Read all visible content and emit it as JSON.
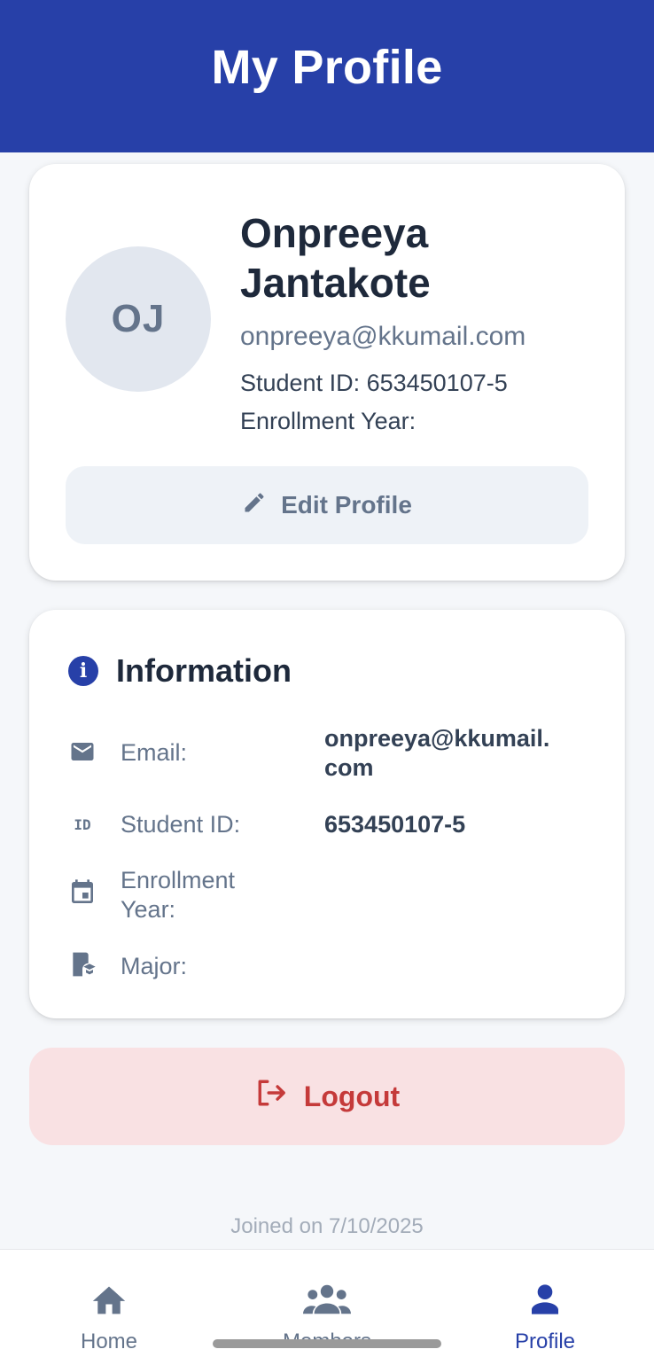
{
  "colors": {
    "primary": "#2740a8",
    "danger": "#c53a3a",
    "muted": "#64748b"
  },
  "header": {
    "title": "My Profile"
  },
  "profile": {
    "initials": "OJ",
    "name": "Onpreeya Jantakote",
    "email": "onpreeya@kkumail.com",
    "student_id_line": "Student ID: 653450107-5",
    "enrollment_line": "Enrollment Year:",
    "edit_label": "Edit Profile",
    "edit_icon": "pencil-icon"
  },
  "information": {
    "title": "Information",
    "icon": "info-icon",
    "rows": [
      {
        "icon": "mail-icon",
        "label": "Email:",
        "value": "onpreeya@kkumail.com"
      },
      {
        "icon": "id-badge-icon",
        "label": "Student ID:",
        "value": "653450107-5"
      },
      {
        "icon": "calendar-icon",
        "label": "Enrollment Year:",
        "value": ""
      },
      {
        "icon": "major-book-icon",
        "label": "Major:",
        "value": ""
      }
    ]
  },
  "logout": {
    "label": "Logout",
    "icon": "logout-icon"
  },
  "footer": {
    "joined": "Joined on 7/10/2025"
  },
  "nav": {
    "items": [
      {
        "label": "Home",
        "icon": "home-icon",
        "active": false
      },
      {
        "label": "Members",
        "icon": "group-icon",
        "active": false
      },
      {
        "label": "Profile",
        "icon": "person-icon",
        "active": true
      }
    ]
  }
}
